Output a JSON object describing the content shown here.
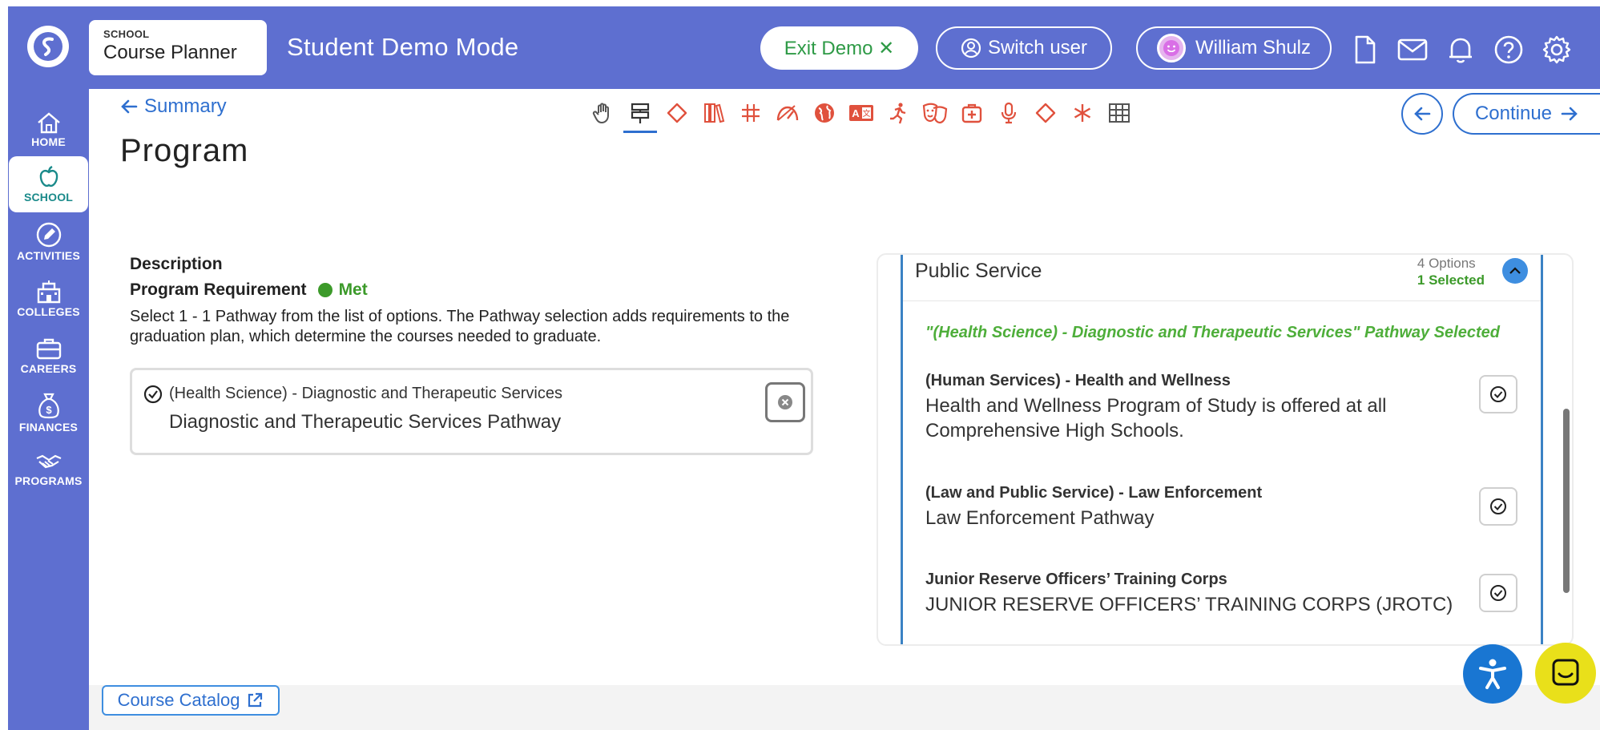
{
  "header": {
    "brand_small": "SCHOOL",
    "brand_name": "Course Planner",
    "mode_title": "Student Demo Mode",
    "exit_demo_label": "Exit Demo ✕",
    "switch_user_label": "Switch user",
    "user_name": "William Shulz",
    "icons": [
      "document-icon",
      "mail-icon",
      "bell-icon",
      "help-icon",
      "gear-icon"
    ]
  },
  "sidebar": {
    "items": [
      {
        "label": "HOME",
        "icon": "home-icon"
      },
      {
        "label": "SCHOOL",
        "icon": "apple-icon",
        "active": true
      },
      {
        "label": "ACTIVITIES",
        "icon": "pencil-icon"
      },
      {
        "label": "COLLEGES",
        "icon": "college-icon"
      },
      {
        "label": "CAREERS",
        "icon": "briefcase-icon"
      },
      {
        "label": "FINANCES",
        "icon": "money-bag-icon"
      },
      {
        "label": "PROGRAMS",
        "icon": "handshake-icon"
      }
    ]
  },
  "main": {
    "back_label": "Summary",
    "title": "Program",
    "continue_label": "Continue",
    "category_icons": [
      "hand-icon",
      "signpost-icon",
      "diamond-icon",
      "books-icon",
      "hashtag-icon",
      "gauge-icon",
      "globe-icon",
      "translate-icon",
      "runner-icon",
      "masks-icon",
      "medkit-icon",
      "microphone-icon",
      "diamond-icon",
      "asterisk-icon",
      "grid-icon"
    ],
    "description_label": "Description",
    "requirement_label": "Program Requirement",
    "requirement_status": "Met",
    "instructions": "Select 1 - 1 Pathway from the list of options. The Pathway selection adds requirements to the graduation plan, which determine the courses needed to graduate.",
    "selected": {
      "title": "(Health Science) - Diagnostic and Therapeutic Services",
      "subtitle": "Diagnostic and Therapeutic Services Pathway"
    }
  },
  "panel": {
    "group_title": "Public Service",
    "options_count": "4 Options",
    "selected_count": "1 Selected",
    "pathway_message": "\"(Health Science) - Diagnostic and Therapeutic Services\" Pathway Selected",
    "options": [
      {
        "title": "(Human Services) - Health and Wellness",
        "subtitle": "Health and Wellness Program of Study is offered at all Comprehensive High Schools."
      },
      {
        "title": "(Law and Public Service) - Law Enforcement",
        "subtitle": "Law Enforcement Pathway"
      },
      {
        "title": "Junior Reserve Officers’ Training Corps",
        "subtitle": "JUNIOR RESERVE OFFICERS’ TRAINING CORPS (JROTC)"
      }
    ]
  },
  "footer": {
    "catalog_label": "Course Catalog"
  },
  "colors": {
    "brand": "#5e6fd0",
    "accent_blue": "#2e6fcf",
    "success": "#3c9a2a",
    "category_icon": "#e0513d"
  }
}
